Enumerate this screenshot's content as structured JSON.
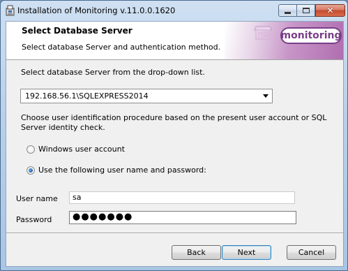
{
  "window": {
    "title": "Installation of Monitoring v.11.0.0.1620",
    "close_glyph": "✕"
  },
  "banner": {
    "title": "Select Database Server",
    "subtitle": "Select database Server and authentication method.",
    "logo_text": "monitoring"
  },
  "main": {
    "instruction": "Select database Server from the drop-down list.",
    "server_select": {
      "selected_value": "192.168.56.1\\SQLEXPRESS2014"
    },
    "auth_description": "Choose user identification procedure based on the present user account or SQL Server identity check.",
    "auth_options": [
      {
        "label": "Windows user account",
        "checked": false
      },
      {
        "label": "Use the following user name and password:",
        "checked": true
      }
    ],
    "user_name": {
      "label": "User name",
      "value": "sa"
    },
    "password": {
      "label": "Password",
      "value": "●●●●●●●"
    }
  },
  "footer": {
    "back_label": "Back",
    "next_label": "Next",
    "cancel_label": "Cancel"
  },
  "colors": {
    "title_bar": "#b9d1ea",
    "close_button": "#c54a2e",
    "logo_purple": "#7a3f88",
    "radio_selected": "#1a5fa8"
  },
  "icons": [
    "installer-app-icon",
    "minimize-icon",
    "maximize-icon",
    "close-icon",
    "dropdown-arrow-icon",
    "shop-icon"
  ]
}
